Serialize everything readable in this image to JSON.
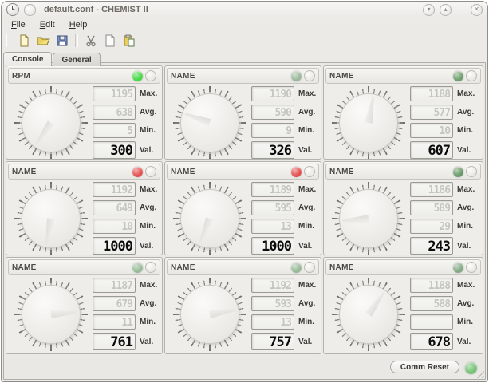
{
  "window": {
    "title": "default.conf - CHEMIST II",
    "controls": {
      "minimize": "▾",
      "maximize": "▴",
      "close": "✕"
    }
  },
  "menu": {
    "items": [
      "File",
      "Edit",
      "Help"
    ]
  },
  "toolbar": {
    "icons": [
      "new-file",
      "open-folder",
      "save",
      "cut",
      "copy",
      "paste"
    ]
  },
  "tabs": [
    {
      "label": "Console",
      "active": true
    },
    {
      "label": "General",
      "active": false
    }
  ],
  "labels": {
    "max": "Max.",
    "avg": "Avg.",
    "min": "Min.",
    "val": "Val."
  },
  "panels": [
    {
      "title": "RPM",
      "led_color": "#46d946",
      "needle_angle": 215,
      "max": "1195",
      "avg": "638",
      "min": "5",
      "val": "300"
    },
    {
      "title": "NAME",
      "led_color": "#9cb89c",
      "needle_angle": 290,
      "max": "1190",
      "avg": "590",
      "min": "9",
      "val": "326"
    },
    {
      "title": "NAME",
      "led_color": "#6fa06f",
      "needle_angle": 10,
      "max": "1188",
      "avg": "577",
      "min": "10",
      "val": "607"
    },
    {
      "title": "NAME",
      "led_color": "#e35050",
      "needle_angle": 190,
      "max": "1192",
      "avg": "649",
      "min": "10",
      "val": "1000"
    },
    {
      "title": "NAME",
      "led_color": "#e35050",
      "needle_angle": 202,
      "max": "1189",
      "avg": "595",
      "min": "13",
      "val": "1000"
    },
    {
      "title": "NAME",
      "led_color": "#699969",
      "needle_angle": 265,
      "max": "1186",
      "avg": "589",
      "min": "29",
      "val": "243"
    },
    {
      "title": "NAME",
      "led_color": "#97bb97",
      "needle_angle": 85,
      "max": "1187",
      "avg": "679",
      "min": "11",
      "val": "761"
    },
    {
      "title": "NAME",
      "led_color": "#98ba98",
      "needle_angle": 80,
      "max": "1192",
      "avg": "593",
      "min": "13",
      "val": "757"
    },
    {
      "title": "NAME",
      "led_color": "#84a984",
      "needle_angle": 35,
      "max": "1188",
      "avg": "588",
      "min": "",
      "val": "678"
    }
  ],
  "footer": {
    "comm_reset_label": "Comm Reset",
    "led_color": "#74c274"
  }
}
